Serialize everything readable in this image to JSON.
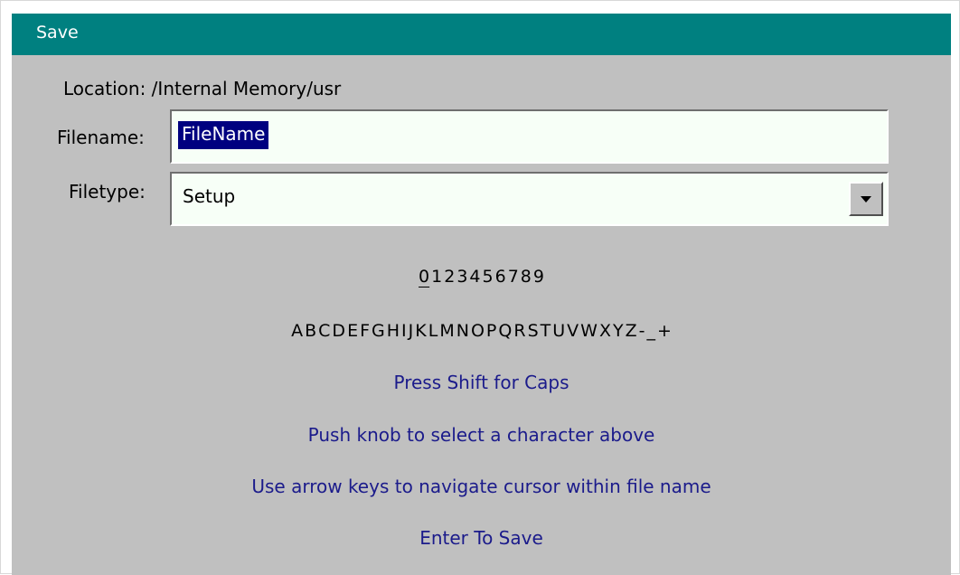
{
  "dialog": {
    "title": "Save",
    "location_text": "Location: /Internal Memory/usr",
    "filename_label": "Filename:",
    "filename_value": "FileName",
    "filetype_label": "Filetype:",
    "filetype_value": "Setup"
  },
  "keyboard": {
    "digits": [
      "0",
      "1",
      "2",
      "3",
      "4",
      "5",
      "6",
      "7",
      "8",
      "9"
    ],
    "letters": [
      "A",
      "B",
      "C",
      "D",
      "E",
      "F",
      "G",
      "H",
      "I",
      "J",
      "K",
      "L",
      "M",
      "N",
      "O",
      "P",
      "Q",
      "R",
      "S",
      "T",
      "U",
      "V",
      "W",
      "X",
      "Y",
      "Z",
      "-",
      "_",
      "+"
    ],
    "cursor_char": "0"
  },
  "hints": {
    "shift": "Press Shift for Caps",
    "knob": "Push knob to select a character above",
    "arrows": "Use arrow keys to navigate cursor within file name",
    "enter": "Enter To Save"
  },
  "colors": {
    "titlebar": "#008080",
    "dialog_bg": "#c0c0c0",
    "selection": "#000080",
    "hint_text": "#1b1b8b"
  },
  "icons": {
    "dropdown": "chevron-down-icon"
  }
}
